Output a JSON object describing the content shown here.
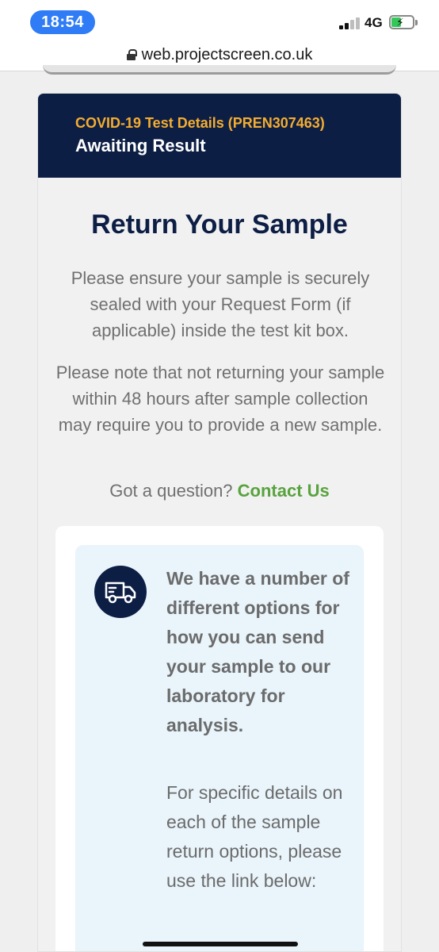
{
  "status_bar": {
    "time": "18:54",
    "network": "4G",
    "signal_bars_active": 2,
    "signal_bars_total": 4,
    "battery_level": 0.45,
    "battery_color": "#34c759",
    "charging": true,
    "charging_icon": "lightning-bolt-icon"
  },
  "browser": {
    "url": "web.projectscreen.co.uk",
    "lock_icon": "lock-icon"
  },
  "header": {
    "subtitle": "COVID-19 Test Details (PREN307463)",
    "status": "Awaiting Result"
  },
  "content": {
    "title": "Return Your Sample",
    "paragraph_1": "Please ensure your sample is securely sealed with your Request Form (if applicable) inside the test kit box.",
    "paragraph_2": "Please note that not returning your sample within 48 hours after sample collection may require you to provide a new sample.",
    "question_prefix": "Got a question?",
    "contact_link": "Contact Us"
  },
  "info_box": {
    "icon": "delivery-van-icon",
    "bold_text": "We have a number of different options for how you can send your sample to our laboratory for analysis.",
    "normal_text": "For specific details on each of the sample return options, please use the link below:"
  },
  "colors": {
    "navy": "#0d1e45",
    "accent_orange": "#f4ad2f",
    "link_green": "#58a33e",
    "info_bg": "#e9f4fb",
    "ios_blue": "#2f7cf6"
  }
}
